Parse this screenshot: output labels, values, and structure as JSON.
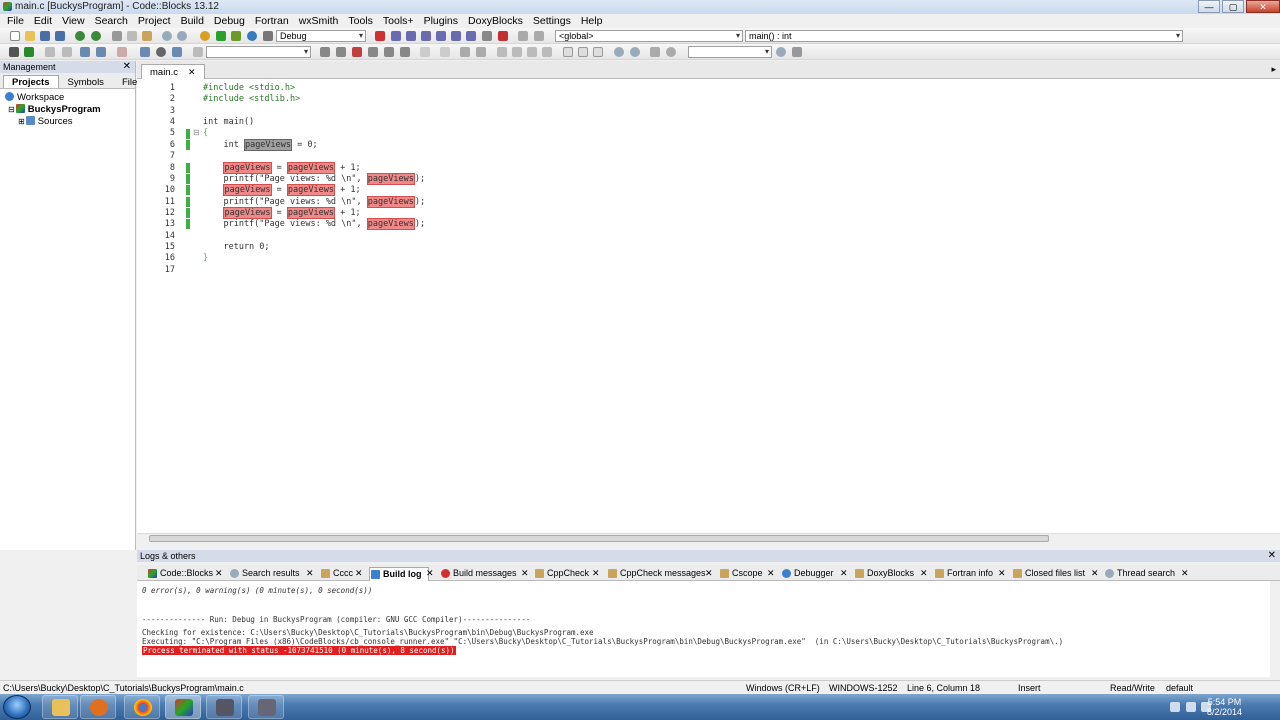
{
  "window": {
    "title": "main.c [BuckysProgram] - Code::Blocks 13.12",
    "buttons": {
      "minimize": "—",
      "maximize": "▢",
      "close": "✕"
    }
  },
  "menu": [
    "File",
    "Edit",
    "View",
    "Search",
    "Project",
    "Build",
    "Debug",
    "Fortran",
    "wxSmith",
    "Tools",
    "Tools+",
    "Plugins",
    "DoxyBlocks",
    "Settings",
    "Help"
  ],
  "toolbar": {
    "build_target": "Debug",
    "scope": "<global>",
    "function": "main() : int",
    "search_value": "",
    "search2_value": ""
  },
  "management": {
    "title": "Management",
    "tabs": [
      "Projects",
      "Symbols",
      "Files"
    ],
    "active_tab": "Projects",
    "tree": [
      {
        "label": "Workspace",
        "bold": false
      },
      {
        "label": "BuckysProgram",
        "bold": true
      },
      {
        "label": "Sources",
        "bold": false
      }
    ]
  },
  "editor": {
    "tab_label": "main.c",
    "line_numbers": [
      "1",
      "2",
      "3",
      "4",
      "5",
      "6",
      "7",
      "8",
      "9",
      "10",
      "11",
      "12",
      "13",
      "14",
      "15",
      "16",
      "17"
    ],
    "lines": {
      "l1": "#include <stdio.h>",
      "l2": "#include <stdlib.h>",
      "l4": "int main()",
      "l5": "{",
      "l6a": "    int ",
      "l6b": "pageViews",
      "l6c": " = 0;",
      "var": "pageViews",
      "assign_eq": " = ",
      "assign_plus": " + 1;",
      "printf_a": "    printf(\"Page views: %d \\n\", ",
      "printf_end": ");",
      "l15": "    return 0;",
      "l16": "}"
    }
  },
  "logs": {
    "title": "Logs & others",
    "tabs": [
      "Code::Blocks",
      "Search results",
      "Cccc",
      "Build log",
      "Build messages",
      "CppCheck",
      "CppCheck messages",
      "Cscope",
      "Debugger",
      "DoxyBlocks",
      "Fortran info",
      "Closed files list",
      "Thread search"
    ],
    "active_tab": "Build log",
    "lines": [
      "0 error(s), 0 warning(s) (0 minute(s), 0 second(s))",
      "-------------- Run: Debug in BuckysProgram (compiler: GNU GCC Compiler)---------------",
      "Checking for existence: C:\\Users\\Bucky\\Desktop\\C_Tutorials\\BuckysProgram\\bin\\Debug\\BuckysProgram.exe",
      "Executing: \"C:\\Program Files (x86)\\CodeBlocks/cb_console_runner.exe\" \"C:\\Users\\Bucky\\Desktop\\C_Tutorials\\BuckysProgram\\bin\\Debug\\BuckysProgram.exe\"  (in C:\\Users\\Bucky\\Desktop\\C_Tutorials\\BuckysProgram\\.)",
      "Process terminated with status -1073741510 (0 minute(s), 8 second(s))"
    ]
  },
  "status": {
    "path": "C:\\Users\\Bucky\\Desktop\\C_Tutorials\\BuckysProgram\\main.c",
    "eol": "Windows (CR+LF)",
    "encoding": "WINDOWS-1252",
    "position": "Line 6, Column 18",
    "mode": "Insert",
    "access": "Read/Write",
    "lang": "default"
  },
  "taskbar": {
    "time": "5:54 PM",
    "date": "8/2/2014"
  },
  "colors": {
    "highlight": "#f08888",
    "error_bg": "#e02020",
    "preprocessor": "#2a7a2a",
    "string": "#0000c0"
  }
}
